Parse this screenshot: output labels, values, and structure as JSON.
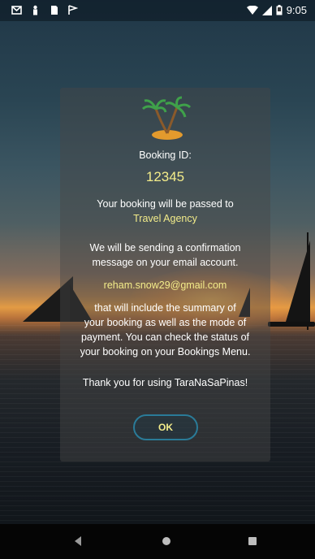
{
  "status_bar": {
    "time": "9:05",
    "left_icons": [
      "gmail-icon",
      "person-icon",
      "sd-card-icon",
      "flag-icon"
    ],
    "right_icons": [
      "wifi-icon",
      "signal-icon",
      "battery-icon"
    ]
  },
  "dialog": {
    "booking_id_label": "Booking ID:",
    "booking_id": "12345",
    "passed_to_text": "Your booking will be passed to",
    "agency": "Travel Agency",
    "confirm_line1": "We will be sending a confirmation",
    "confirm_line2": "message on your email account.",
    "email": "reham.snow29@gmail.com",
    "summary_line1": "that will include the summary of",
    "summary_line2": "your booking as well as the mode of",
    "summary_line3": "payment. You can check the status of",
    "summary_line4": "your booking on your Bookings Menu.",
    "thanks": "Thank you for using TaraNaSaPinas!",
    "ok_label": "OK"
  },
  "nav_bar": {
    "buttons": [
      "back-icon",
      "home-icon",
      "recents-icon"
    ]
  },
  "colors": {
    "accent_yellow": "#f3ec8a",
    "button_border": "#2a7b98"
  }
}
